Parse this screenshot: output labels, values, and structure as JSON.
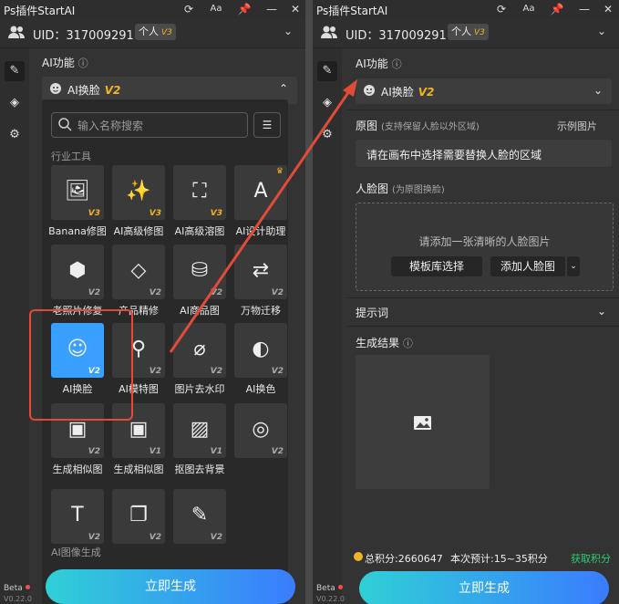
{
  "app": {
    "title": "Ps插件StartAI",
    "uid_label": "UID：317009291",
    "plan": "个人",
    "plan_ver": "V3",
    "beta": "Beta",
    "version": "V0.22.0"
  },
  "left": {
    "section_title": "AI功能",
    "selected_feature": "AI换脸",
    "selected_ver": "V2",
    "search_placeholder": "输入名称搜索",
    "cat_industry": "行业工具",
    "cat_gen": "AI图像生成",
    "tiles": [
      {
        "label": "Banana修图",
        "ver": "V3",
        "gold": true,
        "icon": "image-edit-icon"
      },
      {
        "label": "AI高级修图",
        "ver": "V3",
        "gold": true,
        "icon": "magic-wand-icon"
      },
      {
        "label": "AI高级溶图",
        "ver": "V3",
        "gold": true,
        "icon": "image-sparkle-icon"
      },
      {
        "label": "AI设计助理",
        "ver": "",
        "gold": true,
        "icon": "design-assistant-icon"
      },
      {
        "label": "老照片修复",
        "ver": "V2",
        "gold": false,
        "icon": "photo-restore-icon"
      },
      {
        "label": "产品精修",
        "ver": "V2",
        "gold": false,
        "icon": "diamond-icon"
      },
      {
        "label": "AI商品图",
        "ver": "V2",
        "gold": false,
        "icon": "shopping-bag-icon"
      },
      {
        "label": "万物迁移",
        "ver": "V2",
        "gold": false,
        "icon": "transfer-icon"
      },
      {
        "label": "AI换脸",
        "ver": "V2",
        "gold": false,
        "icon": "face-swap-icon"
      },
      {
        "label": "AI模特图",
        "ver": "V2",
        "gold": false,
        "icon": "model-icon"
      },
      {
        "label": "图片去水印",
        "ver": "V2",
        "gold": false,
        "icon": "remove-watermark-icon"
      },
      {
        "label": "AI换色",
        "ver": "V2",
        "gold": false,
        "icon": "recolor-icon"
      },
      {
        "label": "生成相似图",
        "ver": "V2",
        "gold": false,
        "icon": "similar-image-icon"
      },
      {
        "label": "生成相似图",
        "ver": "V1",
        "gold": false,
        "icon": "similar-image-icon"
      },
      {
        "label": "抠图去背景",
        "ver": "V1",
        "gold": false,
        "icon": "remove-bg-icon"
      },
      {
        "label": "",
        "ver": "V2",
        "gold": false,
        "icon": "lens-icon"
      },
      {
        "label": "",
        "ver": "V2",
        "gold": false,
        "icon": "text-image-icon"
      },
      {
        "label": "",
        "ver": "V2",
        "gold": false,
        "icon": "image-stack-icon"
      },
      {
        "label": "",
        "ver": "V2",
        "gold": false,
        "icon": "image-edit2-icon"
      }
    ],
    "generate": "立即生成"
  },
  "right": {
    "section_title": "AI功能",
    "selected_feature": "AI换脸",
    "selected_ver": "V2",
    "original_label": "原图",
    "original_sub": "(支持保留人脸以外区域)",
    "example_label": "示例图片",
    "original_prompt": "请在画布中选择需要替换人脸的区域",
    "face_label": "人脸图",
    "face_sub": "(为原图换脸)",
    "face_hint": "请添加一张清晰的人脸图片",
    "template_btn": "模板库选择",
    "add_face_btn": "添加人脸图",
    "prompt_label": "提示词",
    "result_label": "生成结果",
    "points_total": "总积分:2660647",
    "points_est": "本次预计:15~35积分",
    "get_points": "获取积分",
    "generate": "立即生成"
  },
  "colors": {
    "accent_blue": "#3aa0ff",
    "gold": "#f0b429",
    "highlight_red": "#e14b3a",
    "green_link": "#2ecc71"
  }
}
